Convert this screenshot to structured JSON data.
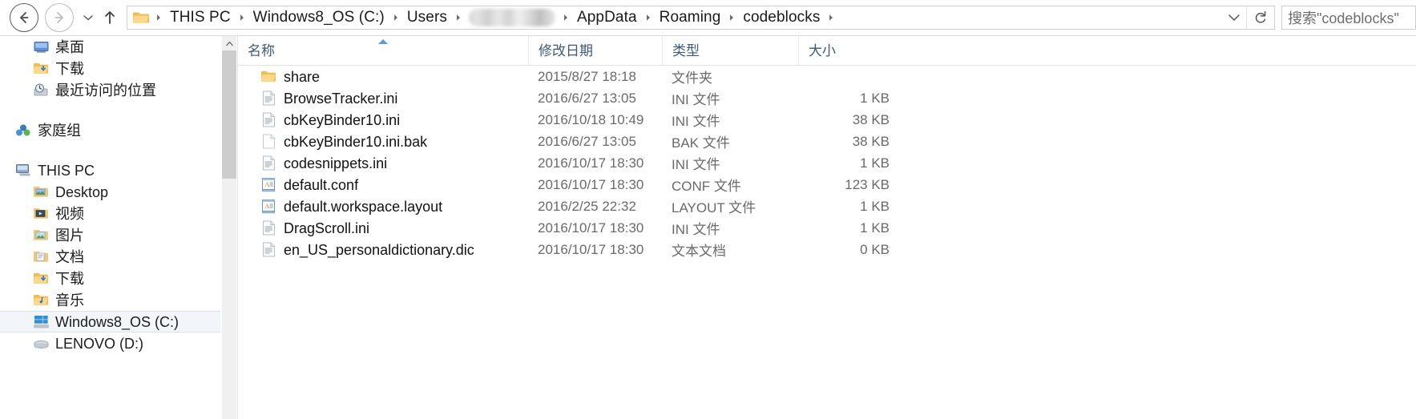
{
  "navigation": {
    "back_tooltip": "后退",
    "forward_tooltip": "前进",
    "recent_dropdown": "最近浏览的位置",
    "up_tooltip": "上移到",
    "breadcrumbs": [
      {
        "label": "THIS PC",
        "redacted": false
      },
      {
        "label": "Windows8_OS (C:)",
        "redacted": false
      },
      {
        "label": "Users",
        "redacted": false
      },
      {
        "label": "",
        "redacted": true
      },
      {
        "label": "AppData",
        "redacted": false
      },
      {
        "label": "Roaming",
        "redacted": false
      },
      {
        "label": "codeblocks",
        "redacted": false
      }
    ],
    "address_dropdown_icon": "chevron-down-icon",
    "refresh_icon": "refresh-icon"
  },
  "search": {
    "placeholder": "搜索\"codeblocks\"",
    "icon": "search-icon"
  },
  "sidebar": {
    "groups": [
      {
        "items": [
          {
            "label": "桌面",
            "icon": "desktop-icon",
            "level": 1,
            "selected": false
          },
          {
            "label": "下载",
            "icon": "downloads-folder-icon",
            "level": 1,
            "selected": false
          },
          {
            "label": "最近访问的位置",
            "icon": "recent-places-icon",
            "level": 1,
            "selected": false
          }
        ]
      },
      {
        "items": [
          {
            "label": "家庭组",
            "icon": "homegroup-icon",
            "level": 0,
            "selected": false
          }
        ]
      },
      {
        "items": [
          {
            "label": "THIS PC",
            "icon": "this-pc-icon",
            "level": 0,
            "selected": false
          },
          {
            "label": "Desktop",
            "icon": "desktop-folder-icon",
            "level": 1,
            "selected": false
          },
          {
            "label": "视频",
            "icon": "videos-folder-icon",
            "level": 1,
            "selected": false
          },
          {
            "label": "图片",
            "icon": "pictures-folder-icon",
            "level": 1,
            "selected": false
          },
          {
            "label": "文档",
            "icon": "documents-folder-icon",
            "level": 1,
            "selected": false
          },
          {
            "label": "下载",
            "icon": "downloads-folder-icon",
            "level": 1,
            "selected": false
          },
          {
            "label": "音乐",
            "icon": "music-folder-icon",
            "level": 1,
            "selected": false
          },
          {
            "label": "Windows8_OS (C:)",
            "icon": "windows-drive-icon",
            "level": 1,
            "selected": true
          },
          {
            "label": "LENOVO (D:)",
            "icon": "hard-drive-icon",
            "level": 1,
            "selected": false
          }
        ]
      }
    ]
  },
  "filelist": {
    "columns": [
      {
        "label": "名称",
        "key": "name",
        "sorted": "asc"
      },
      {
        "label": "修改日期",
        "key": "date",
        "sorted": ""
      },
      {
        "label": "类型",
        "key": "type",
        "sorted": ""
      },
      {
        "label": "大小",
        "key": "size",
        "sorted": ""
      }
    ],
    "rows": [
      {
        "name": "share",
        "date": "2015/8/27 18:18",
        "type": "文件夹",
        "size": "",
        "icon": "folder-icon"
      },
      {
        "name": "BrowseTracker.ini",
        "date": "2016/6/27 13:05",
        "type": "INI 文件",
        "size": "1 KB",
        "icon": "ini-file-icon"
      },
      {
        "name": "cbKeyBinder10.ini",
        "date": "2016/10/18 10:49",
        "type": "INI 文件",
        "size": "38 KB",
        "icon": "ini-file-icon"
      },
      {
        "name": "cbKeyBinder10.ini.bak",
        "date": "2016/6/27 13:05",
        "type": "BAK 文件",
        "size": "38 KB",
        "icon": "blank-file-icon"
      },
      {
        "name": "codesnippets.ini",
        "date": "2016/10/17 18:30",
        "type": "INI 文件",
        "size": "1 KB",
        "icon": "ini-file-icon"
      },
      {
        "name": "default.conf",
        "date": "2016/10/17 18:30",
        "type": "CONF 文件",
        "size": "123 KB",
        "icon": "conf-file-icon"
      },
      {
        "name": "default.workspace.layout",
        "date": "2016/2/25 22:32",
        "type": "LAYOUT 文件",
        "size": "1 KB",
        "icon": "conf-file-icon"
      },
      {
        "name": "DragScroll.ini",
        "date": "2016/10/17 18:30",
        "type": "INI 文件",
        "size": "1 KB",
        "icon": "ini-file-icon"
      },
      {
        "name": "en_US_personaldictionary.dic",
        "date": "2016/10/17 18:30",
        "type": "文本文档",
        "size": "0 KB",
        "icon": "text-file-icon"
      }
    ]
  },
  "colors": {
    "header_text": "#3d5a73",
    "secondary_text": "#6a6a6a",
    "selection_bg": "#f2f6fb",
    "sort_arrow": "#5b9bd5",
    "folder_yellow": "#f5c14e"
  }
}
